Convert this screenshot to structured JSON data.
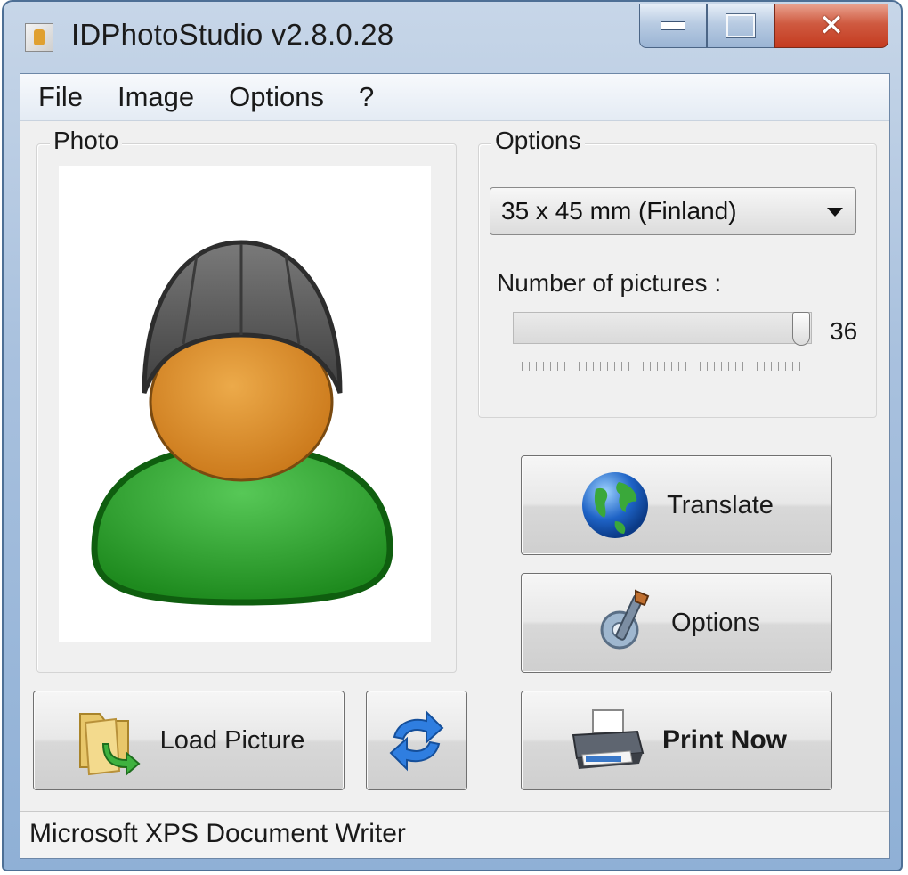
{
  "window": {
    "title": "IDPhotoStudio v2.8.0.28"
  },
  "menu": {
    "items": [
      "File",
      "Image",
      "Options",
      "?"
    ]
  },
  "photo_group": {
    "label": "Photo"
  },
  "options_group": {
    "label": "Options",
    "format_select": {
      "value": "35 x 45 mm (Finland)"
    },
    "num_pictures_label": "Number of pictures :",
    "num_pictures_value": "36"
  },
  "buttons": {
    "translate": "Translate",
    "options": "Options",
    "print_now": "Print Now",
    "load_picture": "Load Picture"
  },
  "status": {
    "printer": "Microsoft XPS Document Writer"
  },
  "colors": {
    "face": "#d98a2b",
    "shirt": "#2f9a2f",
    "hat": "#5a5a5a",
    "accent_globe": "#1e63c6"
  }
}
